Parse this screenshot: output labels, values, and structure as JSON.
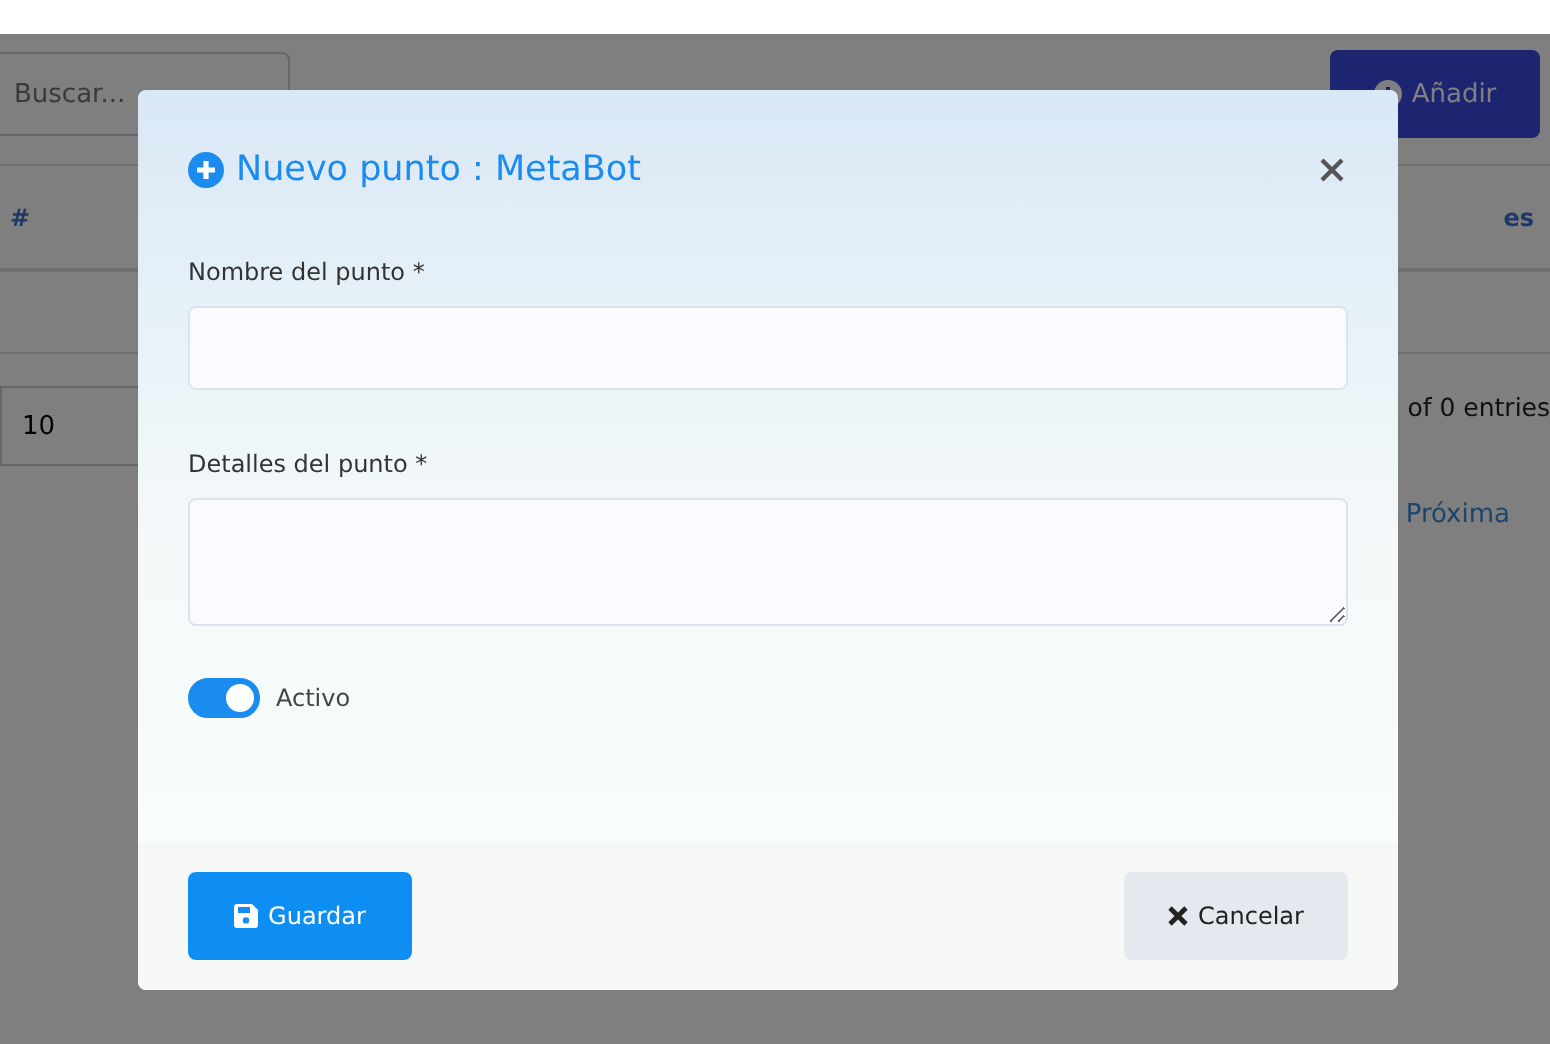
{
  "page": {
    "search": {
      "placeholder": "Buscar..."
    },
    "add_button": "Añadir",
    "table": {
      "columns": [
        "#",
        "es"
      ]
    },
    "page_size": "10",
    "entries_info": "of 0 entries",
    "next_link": "Próxima"
  },
  "modal": {
    "title": "Nuevo punto : MetaBot",
    "fields": [
      {
        "kind": "input",
        "label": "Nombre del punto",
        "required_mark": "*"
      },
      {
        "kind": "textarea",
        "label": "Detalles del punto",
        "required_mark": "*"
      }
    ],
    "toggle": {
      "label": "Activo",
      "on": true
    },
    "buttons": [
      {
        "kind": "save",
        "label": "Guardar"
      },
      {
        "kind": "cancel",
        "label": "Cancelar"
      }
    ]
  }
}
